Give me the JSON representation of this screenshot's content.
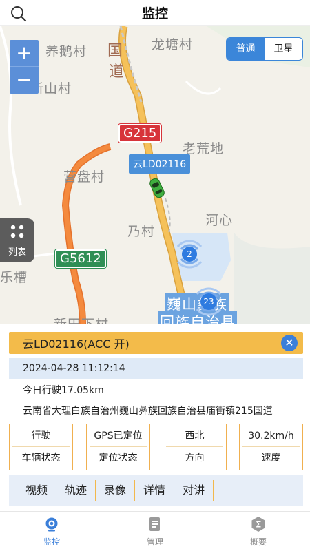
{
  "header": {
    "title": "监控"
  },
  "map": {
    "zoom_in": "+",
    "zoom_out": "−",
    "map_types": [
      "普通",
      "卫星"
    ],
    "active_map_type": "普通",
    "list_button": "列表",
    "vehicle_label": "云LD02116",
    "roads": [
      "G215",
      "G5612"
    ],
    "places": [
      "养鹅村",
      "龙塘村",
      "新山村",
      "老荒地",
      "营盘村",
      "河心",
      "乃村",
      "乐槽",
      "新田下村",
      "国",
      "道",
      "巍山彝族",
      "回族自治县"
    ],
    "clusters": [
      "2",
      "23"
    ]
  },
  "vehicle": {
    "header": "云LD02116(ACC 开)",
    "close": "✕",
    "datetime": "2024-04-28 11:12:14",
    "mileage": "今日行驶17.05km",
    "address": "云南省大理白族自治州巍山彝族回族自治县庙街镇215国道",
    "status": [
      {
        "value": "行驶",
        "key": "车辆状态"
      },
      {
        "value": "GPS已定位",
        "key": "定位状态"
      },
      {
        "value": "西北",
        "key": "方向"
      },
      {
        "value": "30.2km/h",
        "key": "速度"
      }
    ],
    "actions": [
      "视频",
      "轨迹",
      "录像",
      "详情",
      "对讲"
    ]
  },
  "tabbar": {
    "items": [
      {
        "label": "监控",
        "icon": "monitor-icon"
      },
      {
        "label": "管理",
        "icon": "manage-icon"
      },
      {
        "label": "概要",
        "icon": "summary-icon"
      }
    ],
    "active": "监控"
  },
  "colors": {
    "accent": "#3b7fd9",
    "header_bar": "#f3bb4a",
    "road": "#f0b44a",
    "expressway": "#e88a3c"
  }
}
